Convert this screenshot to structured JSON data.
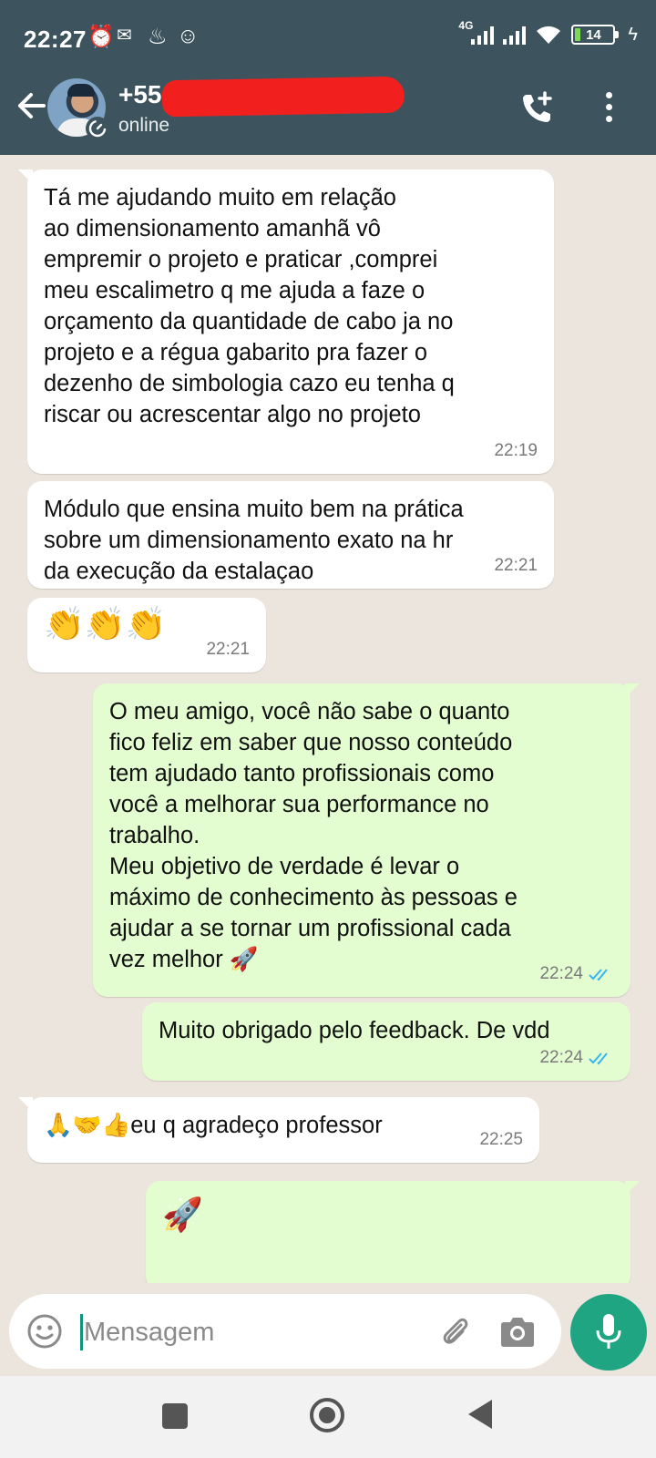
{
  "status_bar": {
    "time": "22:27",
    "network": "4G",
    "battery": "14"
  },
  "header": {
    "contact_name": "+55 45 98",
    "status": "online",
    "icons": [
      "back-arrow-icon",
      "avatar",
      "disappearing-timer-icon",
      "add-call-icon",
      "more-vert-icon"
    ]
  },
  "messages": [
    {
      "direction": "in",
      "text": "Tá me ajudando  muito  em relação\nao dimensionamento  amanhã  vô\nempremir o projeto  e praticar  ,comprei\nmeu  escalimetro q me ajuda a faze o\norçamento da quantidade de cabo  ja no\nprojeto e a régua  gabarito  pra fazer  o\ndezenho  de simbologia  cazo eu tenha q\nriscar ou acrescentar algo no projeto",
      "time": "22:19"
    },
    {
      "direction": "in",
      "text": "Módulo que  ensina muito bem  na prática\nsobre  um dimensionamento  exato   na hr\nda execução da estalaçao",
      "time": "22:21"
    },
    {
      "direction": "in",
      "text": "👏👏👏",
      "time": "22:21"
    },
    {
      "direction": "out",
      "text": "O meu amigo, você não sabe o quanto\nfico feliz em saber que nosso conteúdo\ntem ajudado tanto profissionais como\nvocê a melhorar sua performance no\ntrabalho.\nMeu objetivo de verdade é levar o\nmáximo de conhecimento às pessoas e\najudar a se tornar um profissional cada\nvez melhor 🚀",
      "time": "22:24",
      "read": true
    },
    {
      "direction": "out",
      "text": "Muito obrigado pelo feedback. De vdd",
      "time": "22:24",
      "read": true
    },
    {
      "direction": "in",
      "text": "🙏🤝👍eu q agradeço professor",
      "time": "22:25"
    },
    {
      "direction": "out",
      "text": "🚀",
      "time": ""
    }
  ],
  "composer": {
    "placeholder": "Mensagem"
  },
  "colors": {
    "header": "#3d545e",
    "chat_background": "#ece5dd",
    "incoming_bubble": "#ffffff",
    "outgoing_bubble": "#e3fdd0",
    "read_ticks": "#34b7f1",
    "mic_button": "#1fa582",
    "redaction": "#f21f1f"
  }
}
